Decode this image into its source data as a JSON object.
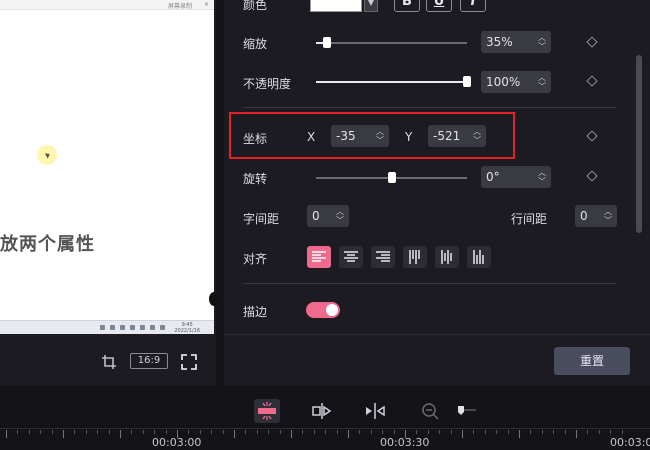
{
  "preview": {
    "topbar_text": "屏幕录制",
    "caption": "放两个属性",
    "taskbar_time": "9:45",
    "taskbar_date": "2022/1/16",
    "ratio": "16:9"
  },
  "properties": {
    "color_label": "颜色",
    "text_styles": [
      "B",
      "U",
      "I"
    ],
    "scale": {
      "label": "缩放",
      "value": "35%",
      "fraction": 0.07
    },
    "opacity": {
      "label": "不透明度",
      "value": "100%",
      "fraction": 1.0
    },
    "position": {
      "label": "坐标",
      "x_label": "X",
      "x_value": "-35",
      "y_label": "Y",
      "y_value": "-521"
    },
    "rotation": {
      "label": "旋转",
      "value": "0°",
      "fraction": 0.5
    },
    "letter_spacing": {
      "label": "字间距",
      "value": "0"
    },
    "line_spacing": {
      "label": "行间距",
      "value": "0"
    },
    "align": {
      "label": "对齐",
      "active_index": 0
    },
    "stroke": {
      "label": "描边",
      "enabled": true
    },
    "reset_label": "重置"
  },
  "timeline": {
    "times": [
      "00:03:00",
      "00:03:30",
      "00:03:0"
    ]
  },
  "colors": {
    "accent": "#ef6a8c",
    "highlight": "#e0232b",
    "panel": "#1b1b21"
  }
}
